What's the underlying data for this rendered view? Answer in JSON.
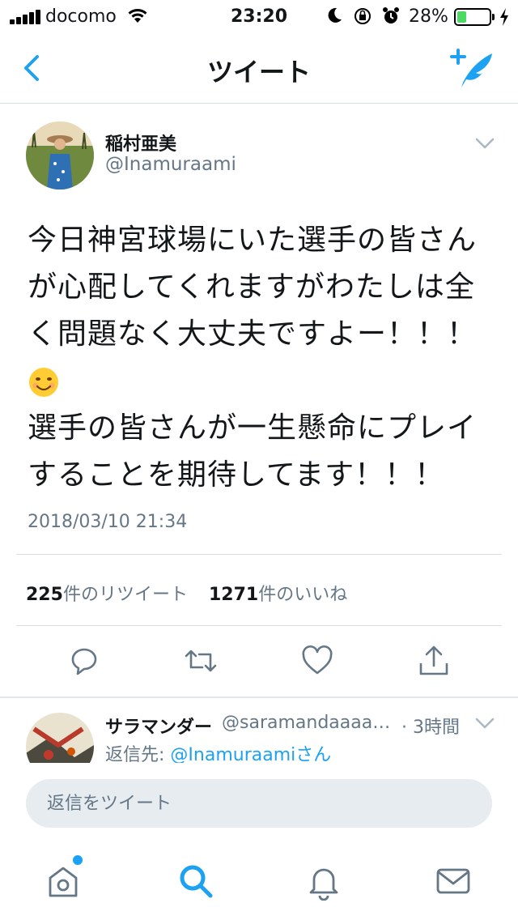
{
  "status_bar": {
    "carrier": "docomo",
    "time": "23:20",
    "battery_percent": "28%",
    "battery_level": 0.28,
    "icons": [
      "signal-icon",
      "wifi-icon",
      "moon-icon",
      "orientation-lock-icon",
      "alarm-icon",
      "battery-icon",
      "charging-icon"
    ]
  },
  "nav": {
    "title": "ツイート",
    "back_icon": "back-chevron-icon",
    "compose_icon": "compose-tweet-icon"
  },
  "tweet": {
    "author_name": "稲村亜美",
    "author_handle": "@Inamuraami",
    "text_line1": "今日神宮球場にいた選手の皆さん",
    "text_line2": "が心配してくれますがわたしは全",
    "text_line3": "く問題なく大丈夫ですよー！！！",
    "text_line5": "選手の皆さんが一生懸命にプレイ",
    "text_line6": "することを期待してます！！！",
    "emoji": "smiling-face-emoji",
    "timestamp": "2018/03/10 21:34",
    "retweet_count": "225",
    "retweet_label": "件のリツイート",
    "like_count": "1271",
    "like_label": "件のいいね"
  },
  "actions": [
    "reply-icon",
    "retweet-icon",
    "like-icon",
    "share-icon"
  ],
  "reply": {
    "name": "サラマンダー",
    "handle": "@saramandaaaaa...",
    "time": "· 3時間",
    "reply_to_prefix": "返信先: ",
    "reply_to_user": "@Inamuraamiさん"
  },
  "composer": {
    "placeholder": "返信をツイート"
  },
  "tabbar": {
    "items": [
      "home-icon",
      "search-icon",
      "notifications-icon",
      "messages-icon"
    ],
    "home_has_badge": true
  },
  "colors": {
    "accent": "#1da1f2",
    "secondary_text": "#657786",
    "divider": "#d8dee3",
    "input_bg": "#e6ecf0"
  }
}
